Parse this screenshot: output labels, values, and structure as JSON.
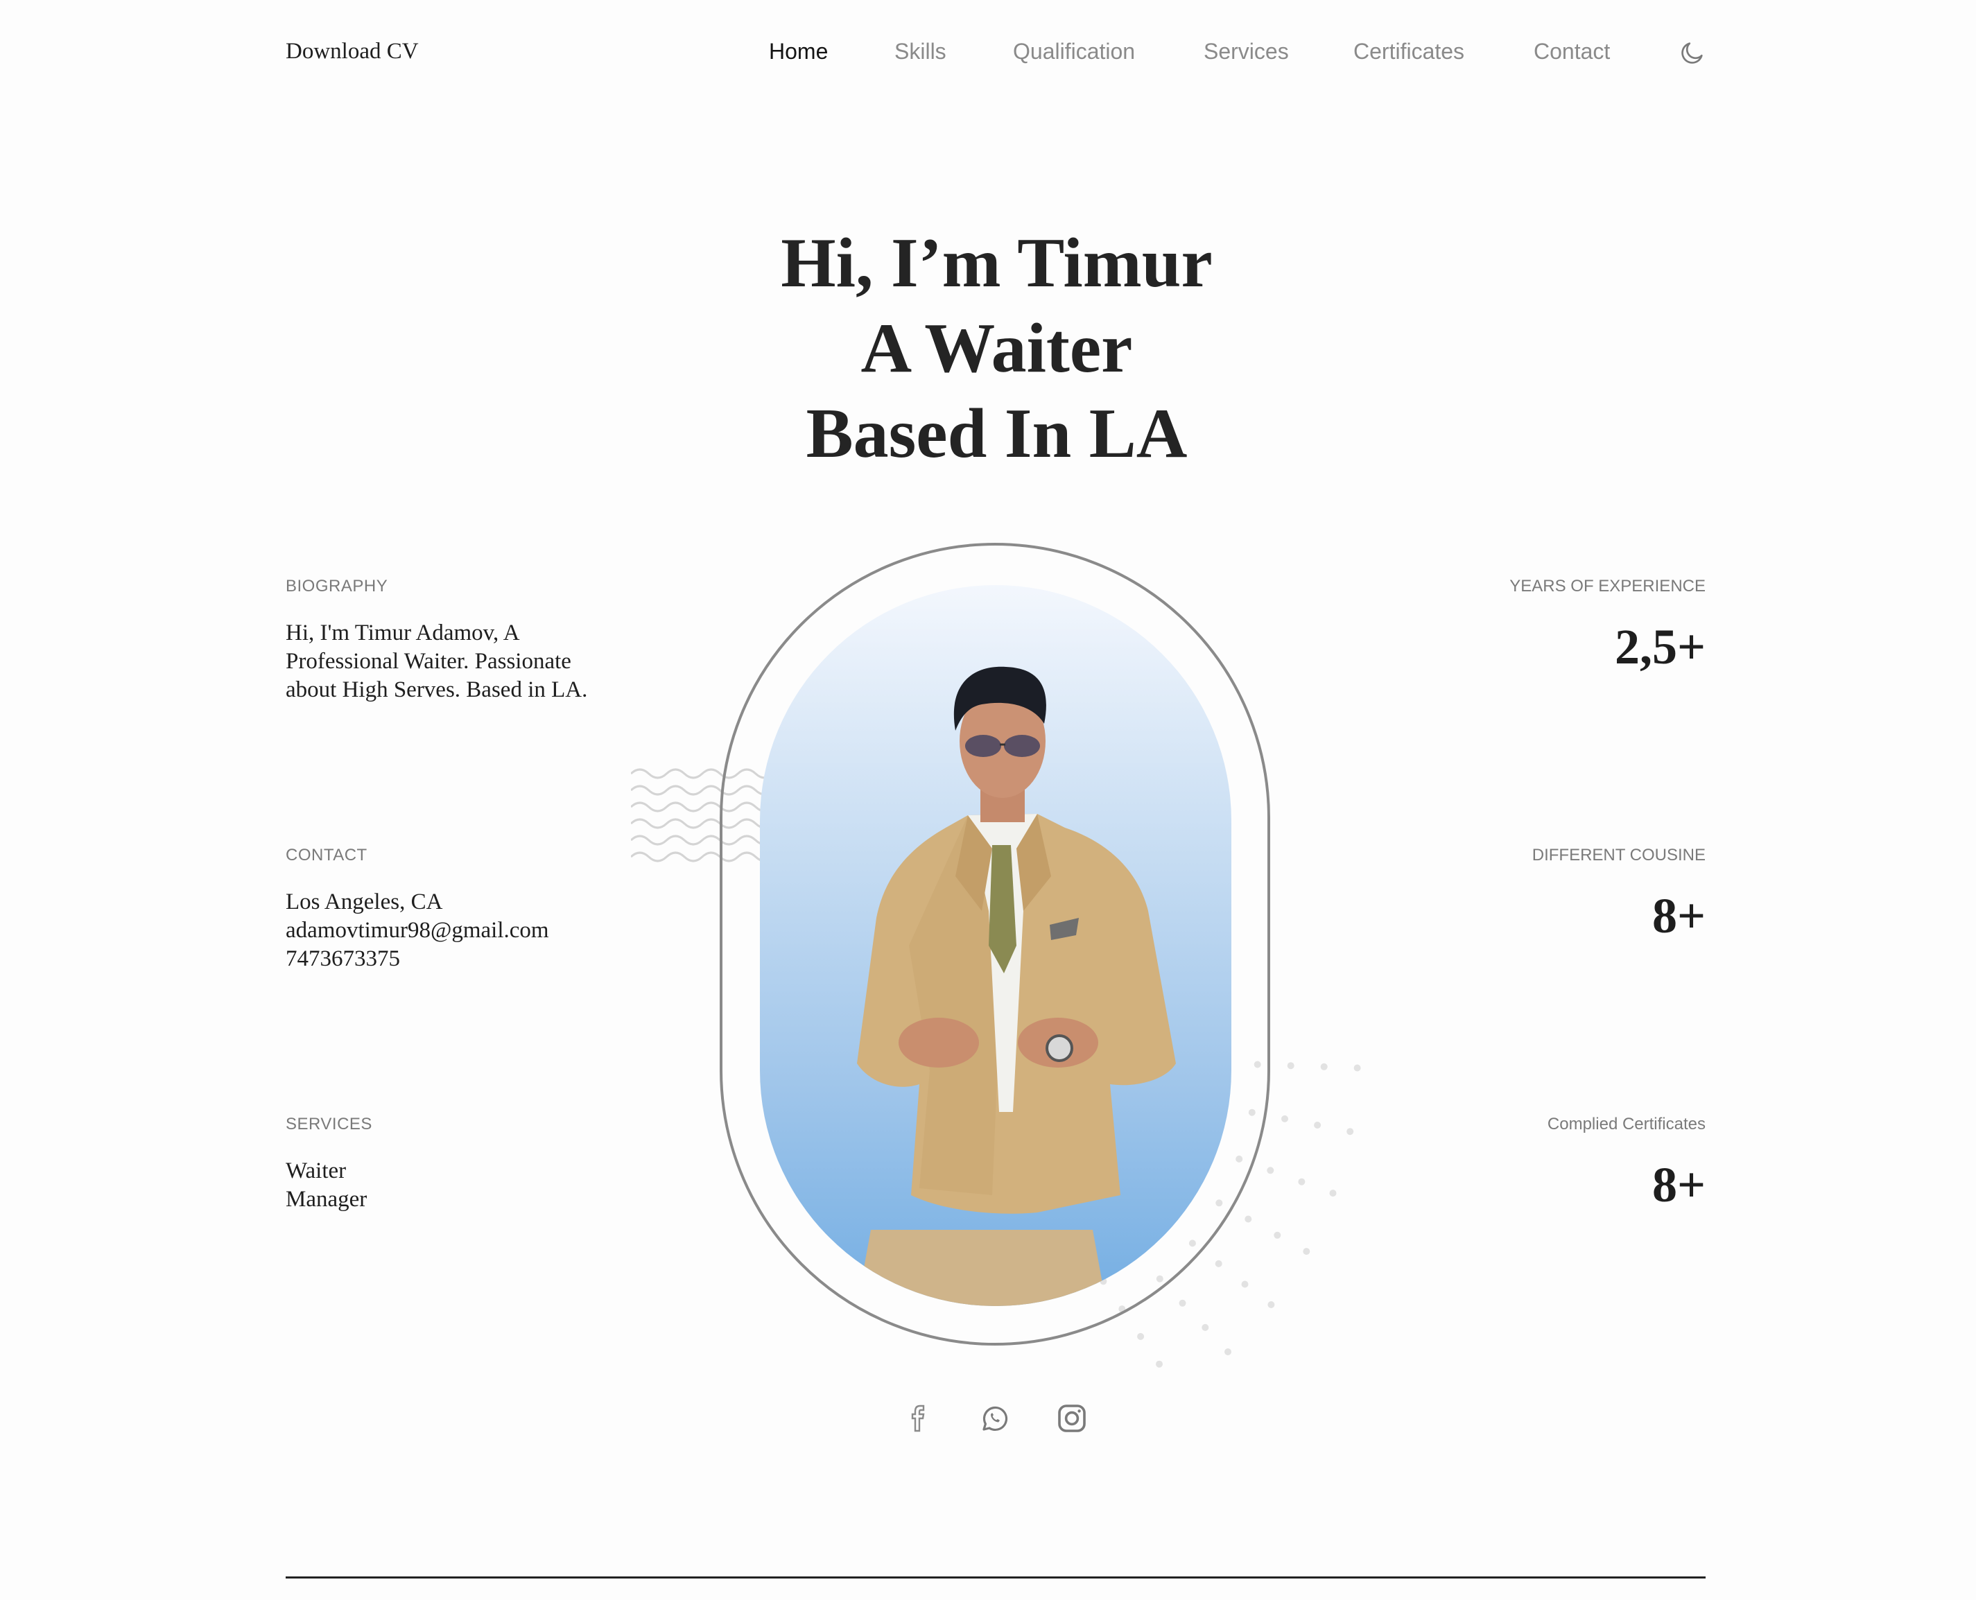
{
  "header": {
    "download_cv": "Download CV",
    "nav": [
      "Home",
      "Skills",
      "Qualification",
      "Services",
      "Certificates",
      "Contact"
    ],
    "active_nav": "Home",
    "theme_icon": "moon-icon"
  },
  "hero": {
    "line1": "Hi, I’m Timur",
    "line2": "A Waiter",
    "line3": "Based In LA"
  },
  "biography": {
    "label": "BIOGRAPHY",
    "lines": [
      "Hi, I'm Timur Adamov, A",
      "Professional Waiter. Passionate",
      "about High Serves. Based in LA."
    ]
  },
  "contact": {
    "label": "CONTACT",
    "location": "Los Angeles, CA",
    "email": "adamovtimur98@gmail.com",
    "phone": "7473673375"
  },
  "services": {
    "label": "SERVICES",
    "items": [
      "Waiter",
      "Manager"
    ]
  },
  "stats": [
    {
      "label": "YEARS OF EXPERIENCE",
      "value": "2,5+"
    },
    {
      "label": "DIFFERENT COUSINE",
      "value": "8+"
    },
    {
      "label": "Complied Certificates",
      "value": "8+"
    }
  ],
  "social": [
    "facebook-icon",
    "whatsapp-icon",
    "instagram-icon"
  ],
  "colors": {
    "background": "#fdfdfd",
    "text": "#1e1e1e",
    "muted": "#8a8a8a",
    "sky_top": "#f3f7fd",
    "sky_bottom": "#74aee3"
  }
}
